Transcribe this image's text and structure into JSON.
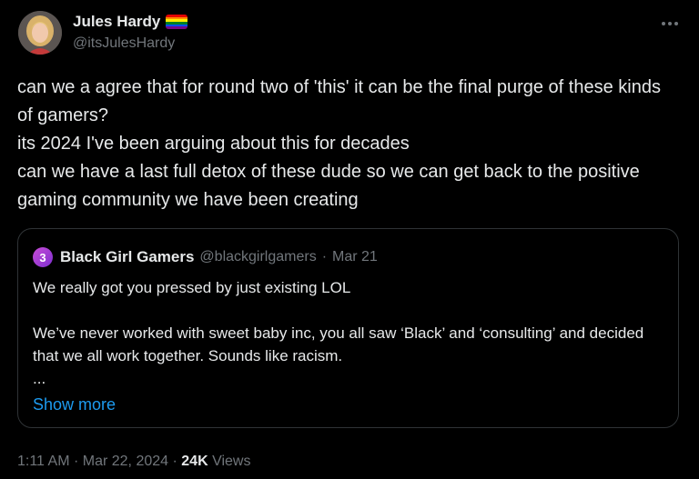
{
  "author": {
    "display_name": "Jules Hardy",
    "handle": "@itsJulesHardy",
    "avatar_icon": "profile-photo-blonde-woman",
    "badge_icon": "pride-flag-icon",
    "pride_colors": [
      "#e40303",
      "#ff8c00",
      "#ffed00",
      "#008026",
      "#004dff",
      "#750787"
    ]
  },
  "menu": {
    "icon": "more-horizontal-icon"
  },
  "tweet": {
    "lines": [
      "can we a agree that for round two of 'this' it can be the final purge of these kinds of gamers?",
      "its 2024 I've been arguing about this for decades",
      "can we have a last full detox of these dude so we can get back to the positive gaming community we have been creating"
    ]
  },
  "quote": {
    "avatar_glyph": "3",
    "avatar_colors": [
      "#c84cd6",
      "#7e2fd0"
    ],
    "name": "Black Girl Gamers",
    "handle": "@blackgirlgamers",
    "separator": "·",
    "date": "Mar 21",
    "line1": "We really got you pressed by just existing LOL",
    "line2": "We’ve never worked with sweet baby inc, you all saw ‘Black’ and ‘consulting’ and decided that we all work together. Sounds like racism.",
    "ellipsis": "...",
    "show_more": "Show more"
  },
  "footer": {
    "time": "1:11 AM",
    "sep1": "·",
    "date": "Mar 22, 2024",
    "sep2": "·",
    "views_count": "24K",
    "views_label": "Views"
  },
  "colors": {
    "background": "#000000",
    "text_primary": "#e7e9ea",
    "text_secondary": "#71767b",
    "link": "#1d9bf0",
    "border": "#2f3336"
  }
}
